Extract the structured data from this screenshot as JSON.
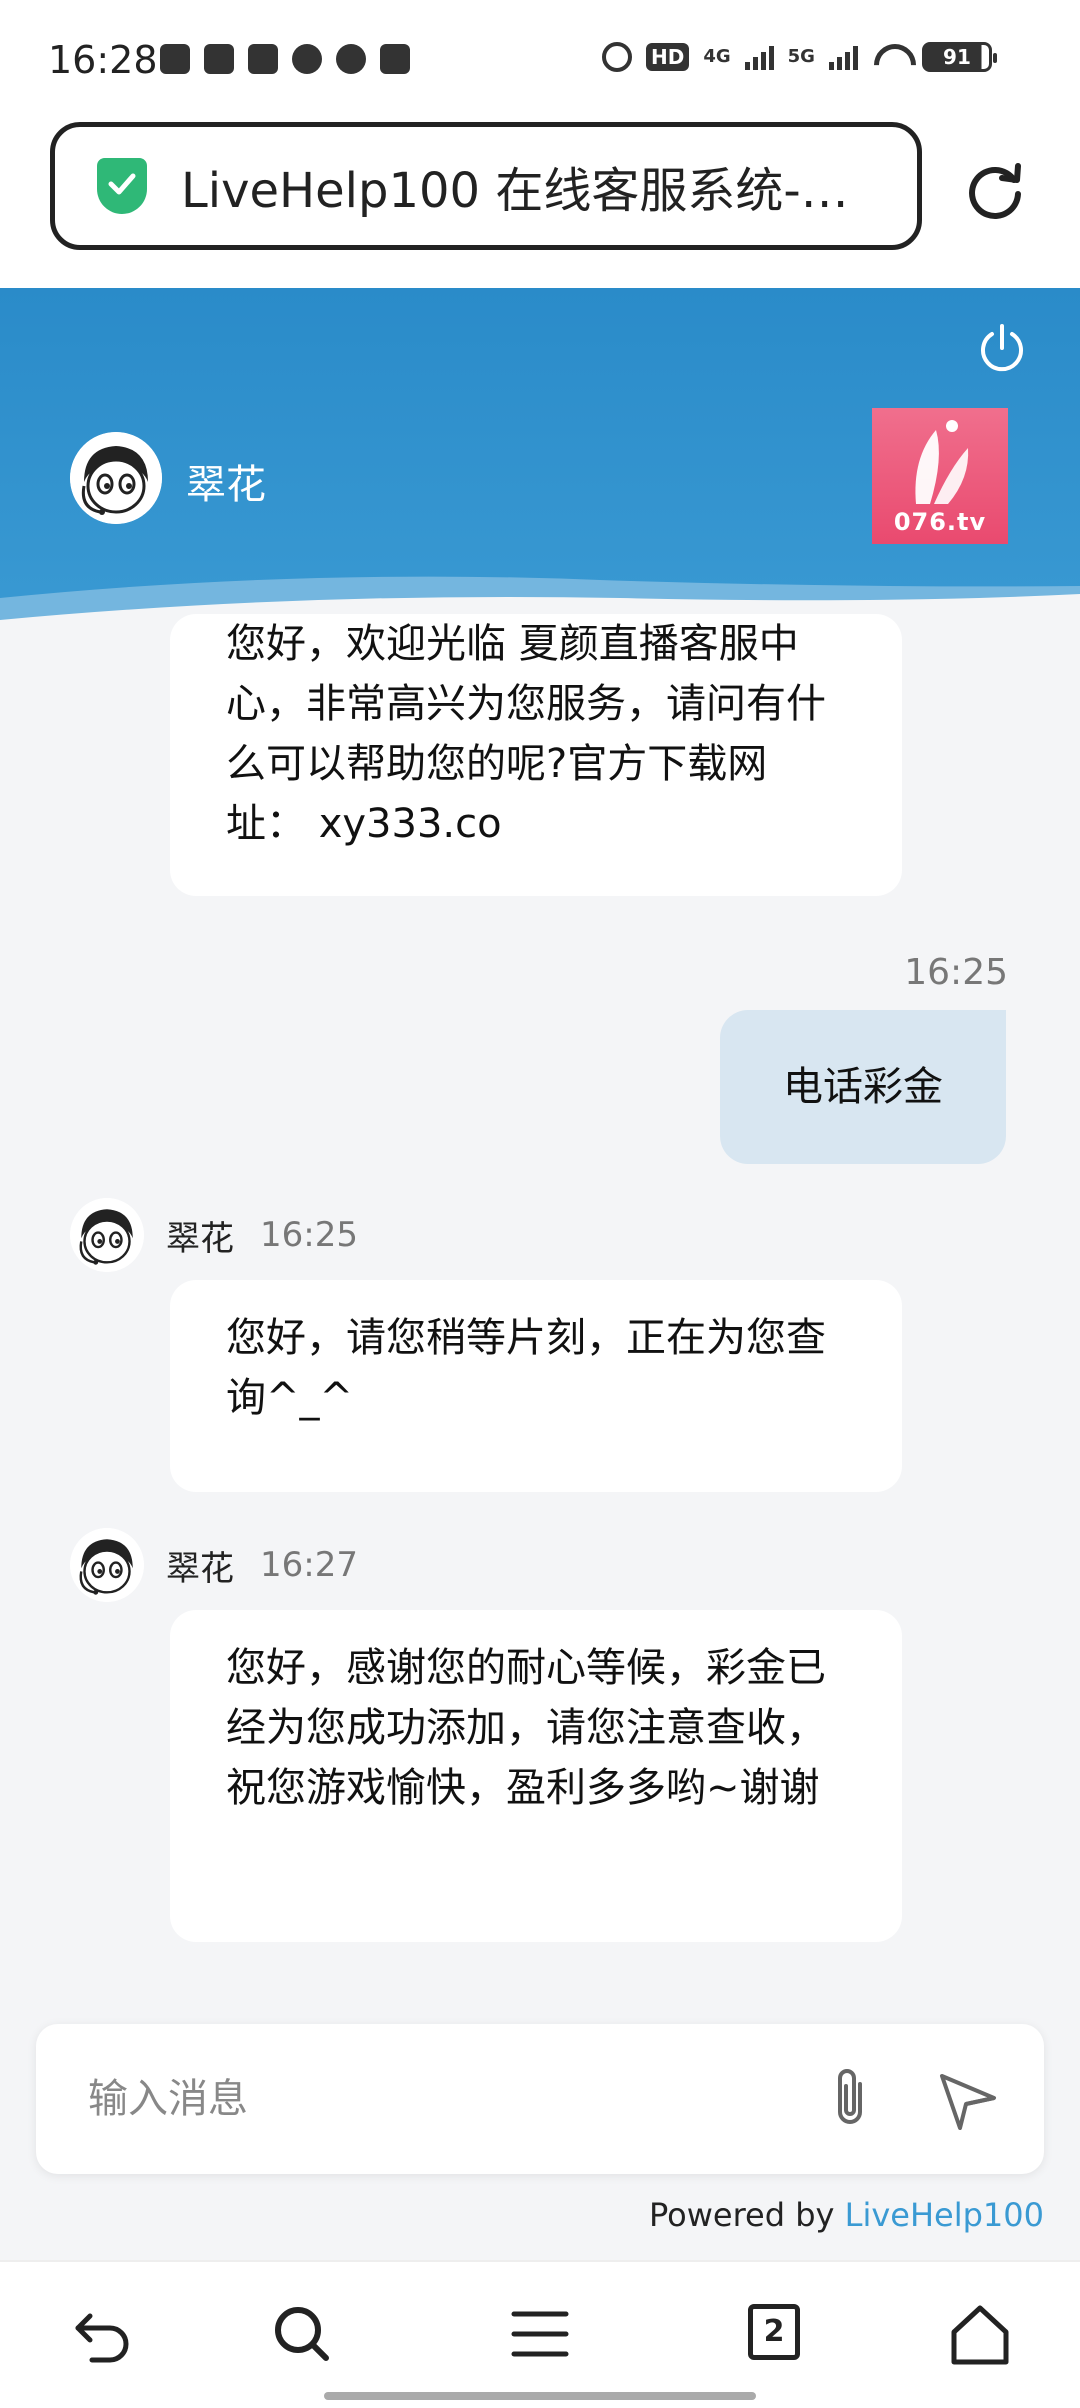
{
  "status_bar": {
    "time": "16:28",
    "hd_label": "HD",
    "net_4g": "4G",
    "net_5g": "5G",
    "battery": "91"
  },
  "browser": {
    "url_title": "LiveHelp100 在线客服系统-…",
    "tab_count": "2"
  },
  "header": {
    "agent_name": "翠花",
    "brand_text": "076.tv",
    "accent_color": "#2a8bc9"
  },
  "messages": [
    {
      "from": "agent",
      "text": "您好，欢迎光临 夏颜直播客服中心，非常高兴为您服务，请问有什么可以帮助您的呢?官方下载网址： xy333.co"
    },
    {
      "from": "user",
      "time": "16:25",
      "text": "电话彩金"
    },
    {
      "from": "agent",
      "name": "翠花",
      "time": "16:25",
      "text": "您好，请您稍等片刻，正在为您查询^_^"
    },
    {
      "from": "agent",
      "name": "翠花",
      "time": "16:27",
      "text": "您好，感谢您的耐心等候，彩金已经为您成功添加，请您注意查收，祝您游戏愉快，盈利多多哟~谢谢"
    }
  ],
  "input": {
    "placeholder": "输入消息",
    "value": ""
  },
  "footer": {
    "powered_by": "Powered by",
    "brand_link": "LiveHelp100"
  }
}
